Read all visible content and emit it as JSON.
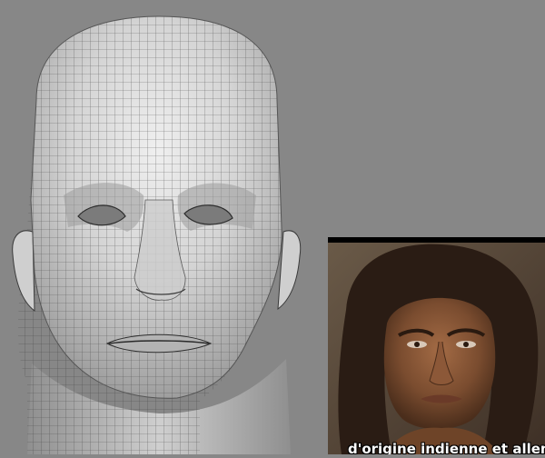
{
  "photo": {
    "subtitle": "d'origine indienne et allem"
  },
  "colors": {
    "background": "#878787",
    "mesh_light": "#e8e8e8",
    "mesh_mid": "#bdbdbd",
    "mesh_dark": "#8f8f8f",
    "wire": "#3a3a3a",
    "skin": "#8a5a3c",
    "hair": "#2a1c14"
  }
}
